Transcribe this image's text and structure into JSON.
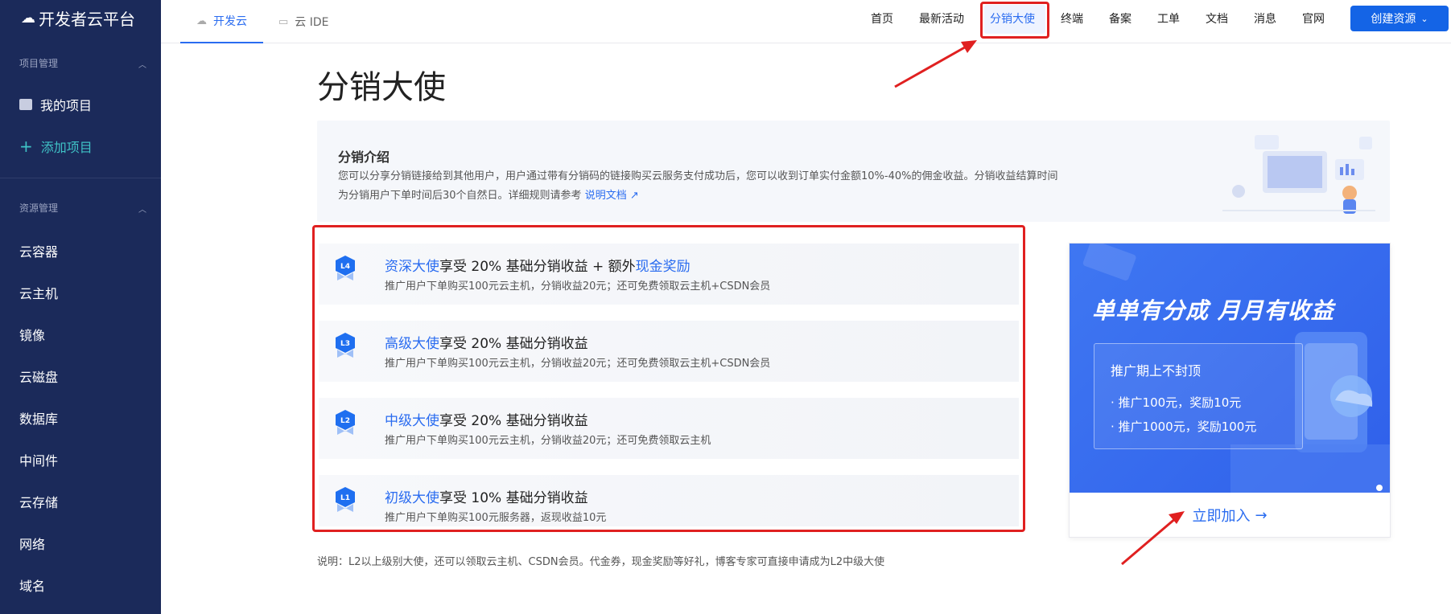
{
  "app": {
    "logo_text": "开发者云平台"
  },
  "sidebar": {
    "section1": {
      "title": "项目管理",
      "items": [
        {
          "label": "我的项目"
        },
        {
          "label": "添加项目"
        }
      ]
    },
    "section2": {
      "title": "资源管理",
      "items": [
        {
          "label": "云容器"
        },
        {
          "label": "云主机"
        },
        {
          "label": "镜像"
        },
        {
          "label": "云磁盘"
        },
        {
          "label": "数据库"
        },
        {
          "label": "中间件"
        },
        {
          "label": "云存储"
        },
        {
          "label": "网络"
        },
        {
          "label": "域名"
        }
      ]
    }
  },
  "topbar": {
    "tabs": [
      {
        "label": "开发云"
      },
      {
        "label": "云 IDE"
      }
    ],
    "nav": [
      {
        "label": "首页"
      },
      {
        "label": "最新活动"
      },
      {
        "label": "分销大使"
      },
      {
        "label": "终端"
      },
      {
        "label": "备案"
      },
      {
        "label": "工单"
      },
      {
        "label": "文档"
      },
      {
        "label": "消息"
      },
      {
        "label": "官网"
      }
    ],
    "create_button": "创建资源"
  },
  "page": {
    "title": "分销大使"
  },
  "intro": {
    "heading": "分销介绍",
    "text": "您可以分享分销链接给到其他用户，用户通过带有分销码的链接购买云服务支付成功后，您可以收到订单实付金额10%-40%的佣金收益。分销收益结算时间为分销用户下单时间后30个自然日。详细规则请参考",
    "link": "说明文档 ↗"
  },
  "levels": [
    {
      "badge": "L4",
      "name": "资深大使",
      "text": "享受 20% 基础分销收益 + 额外",
      "extra": "现金奖励",
      "desc": "推广用户下单购买100元云主机，分销收益20元；还可免费领取云主机+CSDN会员"
    },
    {
      "badge": "L3",
      "name": "高级大使",
      "text": "享受 20% 基础分销收益",
      "extra": "",
      "desc": "推广用户下单购买100元云主机，分销收益20元；还可免费领取云主机+CSDN会员"
    },
    {
      "badge": "L2",
      "name": "中级大使",
      "text": "享受 20% 基础分销收益",
      "extra": "",
      "desc": "推广用户下单购买100元云主机，分销收益20元；还可免费领取云主机"
    },
    {
      "badge": "L1",
      "name": "初级大使",
      "text": "享受 10% 基础分销收益",
      "extra": "",
      "desc": "推广用户下单购买100元服务器，返现收益10元"
    }
  ],
  "note": "说明：L2以上级别大使，还可以领取云主机、CSDN会员。代金券，现金奖励等好礼，博客专家可直接申请成为L2中级大使",
  "promo": {
    "headline": "单单有分成 月月有收益",
    "panel_title": "推广期上不封顶",
    "bullets": [
      "· 推广100元，奖励10元",
      "· 推广1000元，奖励100元"
    ],
    "join_label": "立即加入",
    "join_icon": "arrow-right-icon"
  },
  "colors": {
    "sidebar": "#1b2a5a",
    "accent": "#2a6cf0",
    "highlight": "#e02020",
    "button": "#1464e6"
  }
}
